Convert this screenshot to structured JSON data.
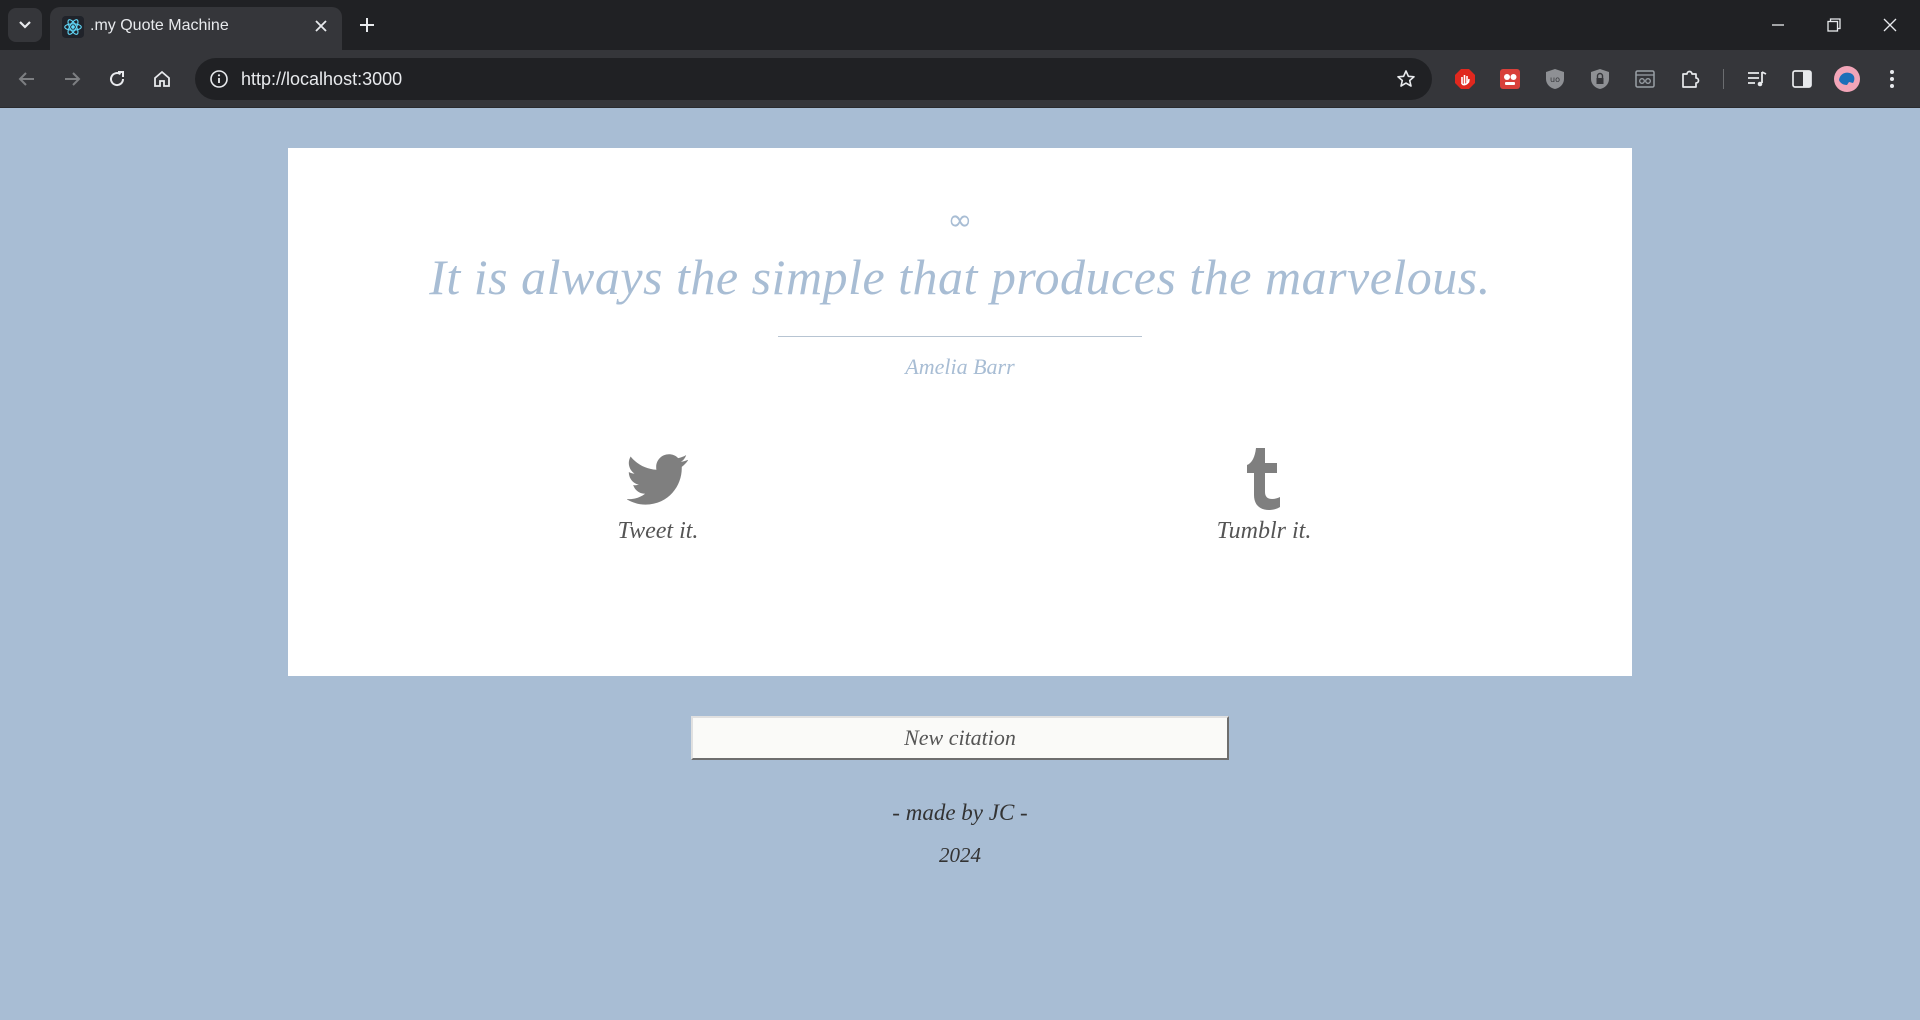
{
  "browser": {
    "tab_title": ".my Quote Machine",
    "url": "http://localhost:3000",
    "icons": {
      "tab_list": "chevron-down-icon",
      "favicon": "react-icon",
      "close": "close-icon",
      "new_tab": "plus-icon",
      "back": "arrow-left-icon",
      "forward": "arrow-right-icon",
      "reload": "reload-icon",
      "home": "home-icon",
      "site_info": "info-icon",
      "bookmark": "star-icon"
    },
    "extensions": [
      "adblock-icon",
      "extension-red-icon",
      "ublock-icon",
      "shield-lock-icon",
      "screen-reader-icon",
      "puzzle-icon"
    ],
    "right_icons": [
      "media-control-icon",
      "side-panel-icon",
      "profile-avatar-icon",
      "more-icon"
    ]
  },
  "main": {
    "quote_symbol": "∞",
    "quote": "It is always the simple that produces the marvelous.",
    "author": "Amelia Barr",
    "tweet_label": "Tweet it.",
    "tumblr_label": "Tumblr it.",
    "new_button_label": "New citation"
  },
  "footer": {
    "made_by": "- made by JC -",
    "year": "2024"
  },
  "colors": {
    "background": "#a8bdd4",
    "card": "#ffffff",
    "quote_text": "#a8bdd4",
    "share_icon": "#7f7f7f"
  }
}
